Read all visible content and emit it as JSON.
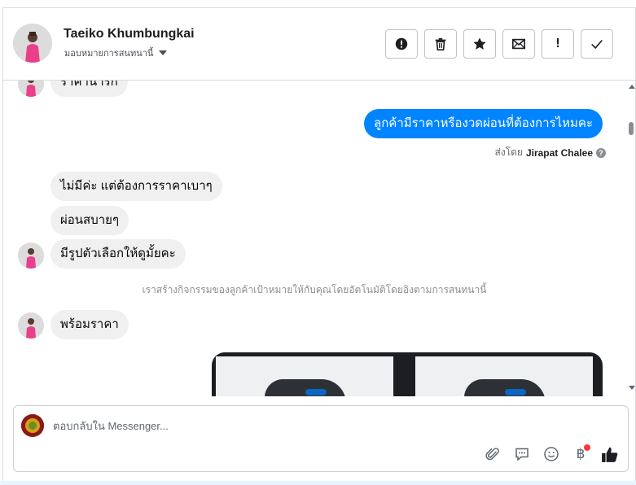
{
  "header": {
    "name": "Taeiko Khumbungkai",
    "assign_label": "มอบหมายการสนทนานี้",
    "actions": [
      {
        "name": "spam-button",
        "icon": "alert-circle-icon"
      },
      {
        "name": "delete-button",
        "icon": "trash-icon"
      },
      {
        "name": "star-button",
        "icon": "star-icon"
      },
      {
        "name": "mark-unread-button",
        "icon": "envelope-icon"
      },
      {
        "name": "follow-up-button",
        "icon": "exclamation-icon",
        "glyph": "!"
      },
      {
        "name": "mark-done-button",
        "icon": "checkmark-icon"
      }
    ]
  },
  "messages": {
    "partial_top": "ราคาน่ารัก",
    "outgoing_1": "ลูกค้ามีราคาหรืองวดผ่อนที่ต้องการไหมคะ",
    "sent_by_prefix": "ส่งโดย",
    "sent_by_name": "Jirapat Chalee",
    "help_glyph": "?",
    "incoming_1": "ไม่มีค่ะ แต่ต้องการราคาเบาๆ",
    "incoming_2": "ผ่อนสบายๆ",
    "incoming_3": "มีรูปตัวเลือกให้ดูมั้ยคะ",
    "system_note": "เราสร้างกิจกรรมของลูกค้าเป้าหมายให้กับคุณโดยอัตโนมัติโดยอิงตามการสนทนานี้",
    "incoming_4": "พร้อมราคา"
  },
  "composer": {
    "placeholder": "ตอบกลับใน Messenger...",
    "baht_glyph": "฿",
    "tools": [
      "paperclip-icon",
      "speech-bubble-icon",
      "smiley-icon",
      "baht-icon",
      "thumbs-up-icon"
    ]
  },
  "colors": {
    "accent": "#0084ff",
    "incoming_bubble": "#f0f0f0",
    "thumbs_up": "#1c1e21"
  }
}
